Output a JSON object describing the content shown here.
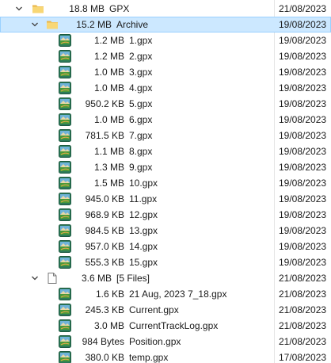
{
  "rows": [
    {
      "size": "18.8 MB",
      "name": "GPX",
      "date": "21/08/2023",
      "type": "folder",
      "level": 0,
      "expanded": true,
      "selected": false
    },
    {
      "size": "15.2 MB",
      "name": "Archive",
      "date": "19/08/2023",
      "type": "folder",
      "level": 1,
      "expanded": true,
      "selected": true
    },
    {
      "size": "1.2 MB",
      "name": "1.gpx",
      "date": "19/08/2023",
      "type": "gpx",
      "level": 2
    },
    {
      "size": "1.2 MB",
      "name": "2.gpx",
      "date": "19/08/2023",
      "type": "gpx",
      "level": 2
    },
    {
      "size": "1.0 MB",
      "name": "3.gpx",
      "date": "19/08/2023",
      "type": "gpx",
      "level": 2
    },
    {
      "size": "1.0 MB",
      "name": "4.gpx",
      "date": "19/08/2023",
      "type": "gpx",
      "level": 2
    },
    {
      "size": "950.2 KB",
      "name": "5.gpx",
      "date": "19/08/2023",
      "type": "gpx",
      "level": 2
    },
    {
      "size": "1.0 MB",
      "name": "6.gpx",
      "date": "19/08/2023",
      "type": "gpx",
      "level": 2
    },
    {
      "size": "781.5 KB",
      "name": "7.gpx",
      "date": "19/08/2023",
      "type": "gpx",
      "level": 2
    },
    {
      "size": "1.1 MB",
      "name": "8.gpx",
      "date": "19/08/2023",
      "type": "gpx",
      "level": 2
    },
    {
      "size": "1.3 MB",
      "name": "9.gpx",
      "date": "19/08/2023",
      "type": "gpx",
      "level": 2
    },
    {
      "size": "1.5 MB",
      "name": "10.gpx",
      "date": "19/08/2023",
      "type": "gpx",
      "level": 2
    },
    {
      "size": "945.0 KB",
      "name": "11.gpx",
      "date": "19/08/2023",
      "type": "gpx",
      "level": 2
    },
    {
      "size": "968.9 KB",
      "name": "12.gpx",
      "date": "19/08/2023",
      "type": "gpx",
      "level": 2
    },
    {
      "size": "984.5 KB",
      "name": "13.gpx",
      "date": "19/08/2023",
      "type": "gpx",
      "level": 2
    },
    {
      "size": "957.0 KB",
      "name": "14.gpx",
      "date": "19/08/2023",
      "type": "gpx",
      "level": 2
    },
    {
      "size": "555.3 KB",
      "name": "15.gpx",
      "date": "19/08/2023",
      "type": "gpx",
      "level": 2
    },
    {
      "size": "3.6 MB",
      "name": "[5 Files]",
      "date": "21/08/2023",
      "type": "files-group",
      "level": 1,
      "expanded": true,
      "selected": false
    },
    {
      "size": "1.6 KB",
      "name": "21 Aug, 2023 7_18.gpx",
      "date": "21/08/2023",
      "type": "gpx",
      "level": 2
    },
    {
      "size": "245.3 KB",
      "name": "Current.gpx",
      "date": "21/08/2023",
      "type": "gpx",
      "level": 2
    },
    {
      "size": "3.0 MB",
      "name": "CurrentTrackLog.gpx",
      "date": "21/08/2023",
      "type": "gpx",
      "level": 2
    },
    {
      "size": "984 Bytes",
      "name": "Position.gpx",
      "date": "21/08/2023",
      "type": "gpx",
      "level": 2
    },
    {
      "size": "380.0 KB",
      "name": "temp.gpx",
      "date": "17/08/2023",
      "type": "gpx",
      "level": 2
    }
  ],
  "icons": {
    "folder": "folder-icon",
    "gpx": "gpx-file-icon",
    "files-group": "file-icon",
    "expand": "chevron-down-icon"
  },
  "colors": {
    "selection": "#cce8ff",
    "selection_border": "#99d1ff",
    "folder": "#f8d775",
    "gpx_bg": "#2d7a5a"
  }
}
